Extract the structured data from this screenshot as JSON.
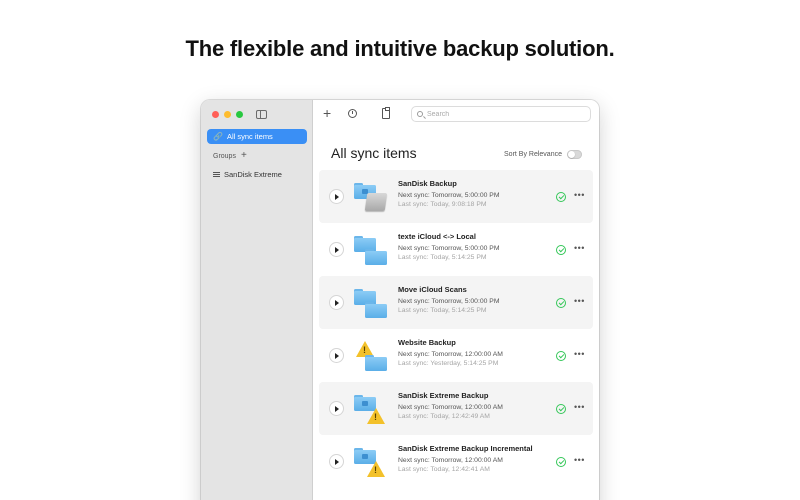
{
  "headline": "The flexible and intuitive backup solution.",
  "sidebar": {
    "all_label": "All sync items",
    "groups_label": "Groups",
    "group_item": "SanDisk Extreme"
  },
  "toolbar": {
    "search_placeholder": "Search"
  },
  "main": {
    "title": "All sync items",
    "sort_label": "Sort By Relevance"
  },
  "items": [
    {
      "name": "SanDisk Backup",
      "next": "Next sync: Tomorrow, 5:00:00 PM",
      "last": "Last sync: Today, 9:08:18 PM",
      "icon": "folder-to-drive",
      "status": "ok"
    },
    {
      "name": "texte iCloud <-> Local",
      "next": "Next sync: Tomorrow, 5:00:00 PM",
      "last": "Last sync: Today, 5:14:25 PM",
      "icon": "folder-to-folder",
      "status": "ok"
    },
    {
      "name": "Move iCloud Scans",
      "next": "Next sync: Tomorrow, 5:00:00 PM",
      "last": "Last sync: Today, 5:14:25 PM",
      "icon": "folder-to-folder",
      "status": "ok"
    },
    {
      "name": "Website Backup",
      "next": "Next sync: Tomorrow, 12:00:00 AM",
      "last": "Last sync: Yesterday, 5:14:25 PM",
      "icon": "warning-to-folder",
      "status": "ok"
    },
    {
      "name": "SanDisk Extreme Backup",
      "next": "Next sync: Tomorrow, 12:00:00 AM",
      "last": "Last sync: Today, 12:42:49 AM",
      "icon": "folder-to-warning",
      "status": "ok"
    },
    {
      "name": "SanDisk Extreme Backup Incremental",
      "next": "Next sync: Tomorrow, 12:00:00 AM",
      "last": "Last sync: Today, 12:42:41 AM",
      "icon": "folder-to-warning",
      "status": "ok"
    }
  ],
  "colors": {
    "accent": "#3a8ff5",
    "success": "#35c759",
    "warning": "#f3c12a",
    "folder": "#6bb6ea"
  }
}
